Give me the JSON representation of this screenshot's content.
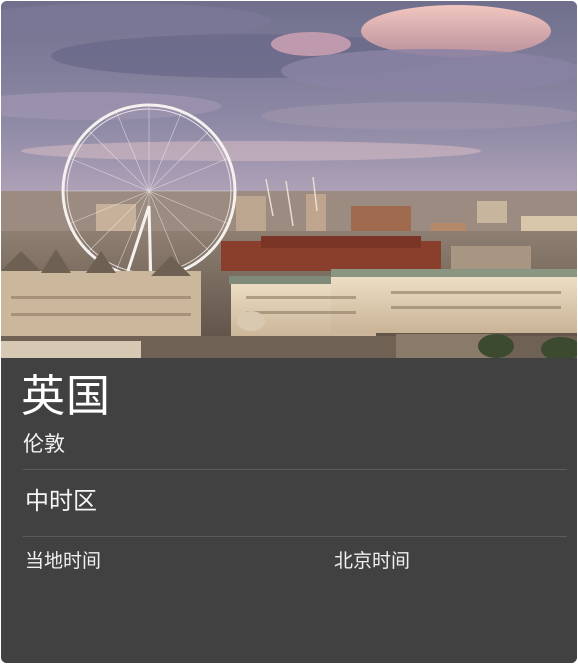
{
  "location": {
    "country": "英国",
    "city": "伦敦"
  },
  "timezone": {
    "name": "中时区"
  },
  "times": {
    "local_label": "当地时间",
    "beijing_label": "北京时间"
  },
  "colors": {
    "panel_background": "#414141",
    "divider": "#5c5c5c",
    "text": "#ffffff"
  }
}
